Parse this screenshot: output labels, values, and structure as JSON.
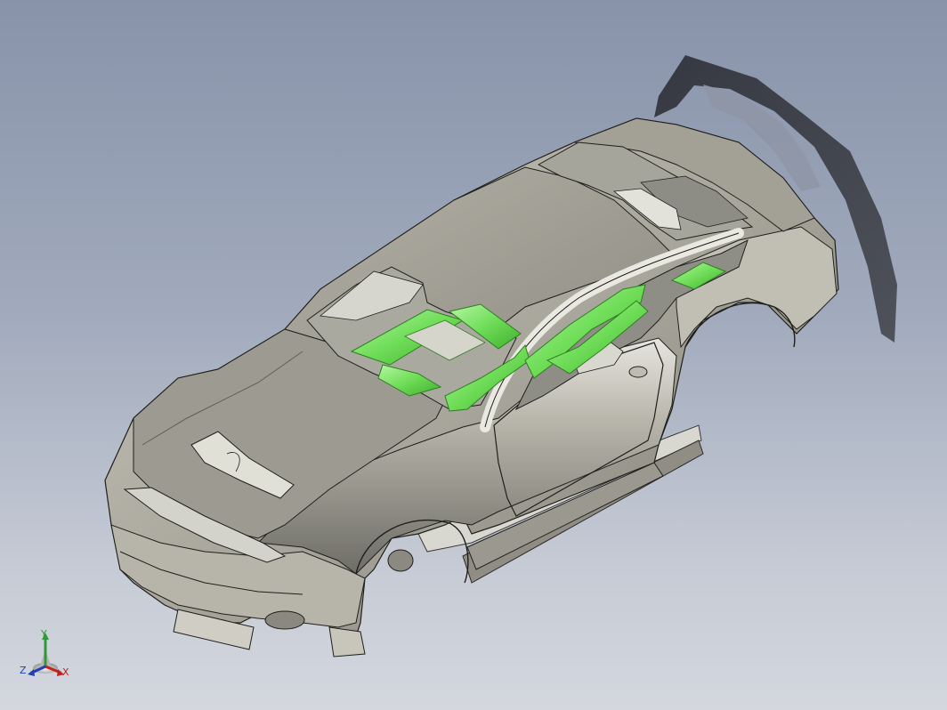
{
  "viewport": {
    "background_top": "#8893aa",
    "background_bottom": "#d4d7de"
  },
  "model": {
    "body_color": "#aeaca1",
    "highlight_color": "#7fe96a",
    "shadow_color": "#3d3f46",
    "edge_color": "#1f1f1c"
  },
  "triad": {
    "x_label": "X",
    "y_label": "Y",
    "z_label": "Z",
    "x_color": "#c42020",
    "y_color": "#2d9a36",
    "z_color": "#1e3fb5"
  }
}
